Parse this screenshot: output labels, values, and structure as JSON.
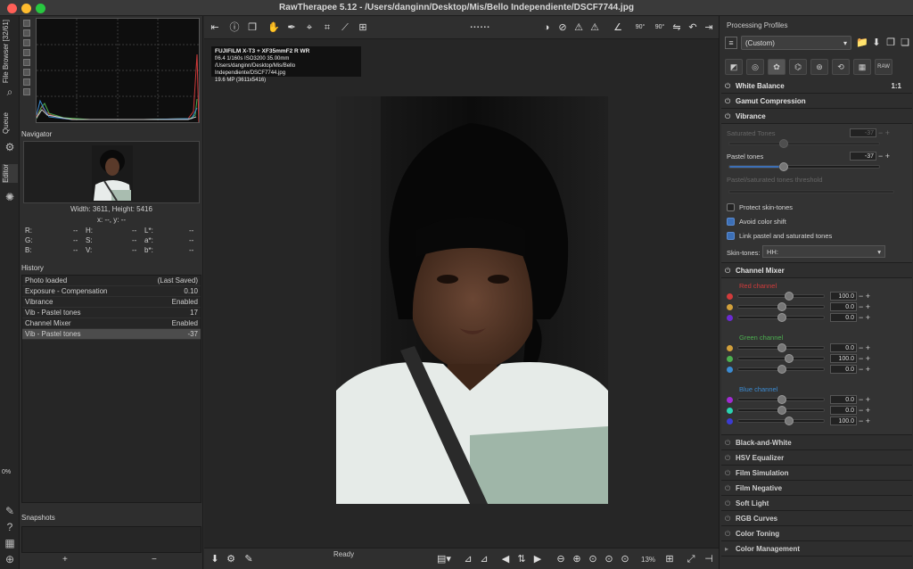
{
  "window": {
    "title": "RawTherapee 5.12 - /Users/danginn/Desktop/Mis/Bello Independiente/DSCF7744.jpg"
  },
  "vtabs": {
    "file_browser": "File Browser [32/61]",
    "queue": "Queue",
    "editor": "Editor",
    "progress": "0%"
  },
  "left": {
    "navigator_title": "Navigator",
    "size_text": "Width: 3611, Height: 5416",
    "xy_text": "x: --, y: --",
    "values": [
      [
        "R:",
        "--",
        "H:",
        "--",
        "L*:",
        "--"
      ],
      [
        "G:",
        "--",
        "S:",
        "--",
        "a*:",
        "--"
      ],
      [
        "B:",
        "--",
        "V:",
        "--",
        "b*:",
        "--"
      ]
    ],
    "history_title": "History",
    "history": [
      {
        "name": "Photo loaded",
        "value": "(Last Saved)"
      },
      {
        "name": "Exposure - Compensation",
        "value": "0.10"
      },
      {
        "name": "Vibrance",
        "value": "Enabled"
      },
      {
        "name": "Vib - Pastel tones",
        "value": "17"
      },
      {
        "name": "Channel Mixer",
        "value": "Enabled"
      },
      {
        "name": "Vib - Pastel tones",
        "value": "-37"
      }
    ],
    "snapshots_title": "Snapshots",
    "snap_add": "+",
    "snap_remove": "−"
  },
  "center": {
    "exif_line1": "FUJIFILM X-T3 + XF35mmF2 R WR",
    "exif_line2": "f/6.4  1/160s  ISO3200  35.00mm",
    "exif_line3": "/Users/danginn/Desktop/Mis/Bello Independiente/DSCF7744.jpg",
    "exif_line4": "19.6 MP (3611x5416)",
    "status": "Ready",
    "zoom": "13%",
    "rotate_left": "90°",
    "rotate_right": "90°"
  },
  "right": {
    "profiles_title": "Processing Profiles",
    "profile_value": "(Custom)",
    "raw_tab": "RAW",
    "tools": {
      "white_balance": "White Balance",
      "wb_ratio": "1:1",
      "gamut": "Gamut Compression",
      "vibrance": "Vibrance",
      "saturated_tones": "Saturated Tones",
      "saturated_value": "-37",
      "pastel_tones": "Pastel tones",
      "pastel_value": "-37",
      "threshold": "Pastel/saturated tones threshold",
      "protect_skin": "Protect skin-tones",
      "avoid_shift": "Avoid color shift",
      "link_tones": "Link pastel and saturated tones",
      "skin_tones_label": "Skin-tones:",
      "skin_tones_value": "HH:",
      "channel_mixer": "Channel Mixer",
      "red_channel": "Red channel",
      "green_channel": "Green channel",
      "blue_channel": "Blue channel",
      "red_vals": [
        "100.0",
        "0.0",
        "0.0"
      ],
      "green_vals": [
        "0.0",
        "100.0",
        "0.0"
      ],
      "blue_vals": [
        "0.0",
        "0.0",
        "100.0"
      ],
      "bw": "Black-and-White",
      "hsv": "HSV Equalizer",
      "film_sim": "Film Simulation",
      "film_neg": "Film Negative",
      "soft_light": "Soft Light",
      "rgb_curves": "RGB Curves",
      "color_toning": "Color Toning",
      "color_mgmt": "Color Management"
    }
  },
  "colors": {
    "accent": "#3c6fb6",
    "red": "#d23b3b",
    "green": "#4caf50",
    "blue": "#3b5bd2"
  }
}
